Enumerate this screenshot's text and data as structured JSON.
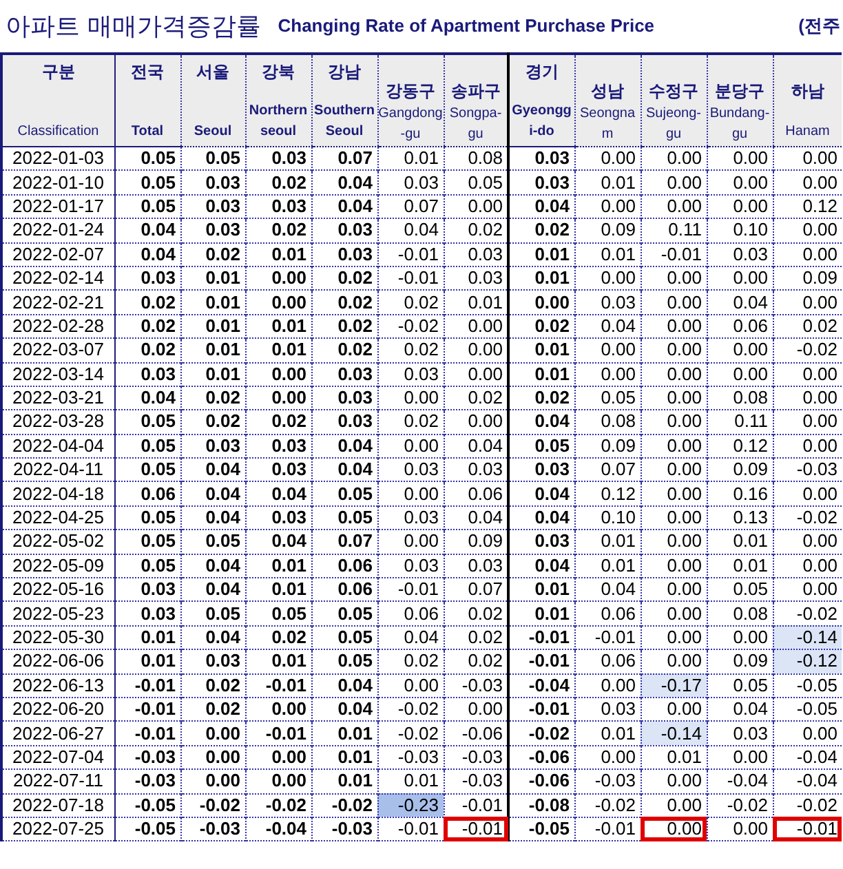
{
  "title": {
    "korean": "아파트 매매가격증감률",
    "english": "Changing Rate of Apartment Purchase Price",
    "note": "(전주"
  },
  "columns": [
    {
      "ko": "구분",
      "en": "Classification",
      "bold": false
    },
    {
      "ko": "전국",
      "en": "Total",
      "bold": true
    },
    {
      "ko": "서울",
      "en": "Seoul",
      "bold": true
    },
    {
      "ko": "강북",
      "en": "Northern seoul",
      "bold": true
    },
    {
      "ko": "강남",
      "en": "Southern Seoul",
      "bold": true
    },
    {
      "ko": "강동구",
      "en": "Gangdong -gu",
      "bold": false
    },
    {
      "ko": "송파구",
      "en": "Songpa- gu",
      "bold": false
    },
    {
      "ko": "경기",
      "en": "Gyeongg i-do",
      "bold": true
    },
    {
      "ko": "성남",
      "en": "Seongna m",
      "bold": false
    },
    {
      "ko": "수정구",
      "en": "Sujeong- gu",
      "bold": false
    },
    {
      "ko": "분당구",
      "en": "Bundang- gu",
      "bold": false
    },
    {
      "ko": "하남",
      "en": "Hanam",
      "bold": false
    }
  ],
  "rows": [
    {
      "date": "2022-01-03",
      "cells": [
        "0.05",
        "0.05",
        "0.03",
        "0.07",
        "0.01",
        "0.08",
        "0.03",
        "0.00",
        "0.00",
        "0.00",
        "0.00"
      ]
    },
    {
      "date": "2022-01-10",
      "cells": [
        "0.05",
        "0.03",
        "0.02",
        "0.04",
        "0.03",
        "0.05",
        "0.03",
        "0.01",
        "0.00",
        "0.00",
        "0.00"
      ]
    },
    {
      "date": "2022-01-17",
      "cells": [
        "0.05",
        "0.03",
        "0.03",
        "0.04",
        "0.07",
        "0.00",
        "0.04",
        "0.00",
        "0.00",
        "0.00",
        "0.12"
      ]
    },
    {
      "date": "2022-01-24",
      "cells": [
        "0.04",
        "0.03",
        "0.02",
        "0.03",
        "0.04",
        "0.02",
        "0.02",
        "0.09",
        "0.11",
        "0.10",
        "0.00"
      ]
    },
    {
      "date": "2022-02-07",
      "cells": [
        "0.04",
        "0.02",
        "0.01",
        "0.03",
        "-0.01",
        "0.03",
        "0.01",
        "0.01",
        "-0.01",
        "0.03",
        "0.00"
      ]
    },
    {
      "date": "2022-02-14",
      "cells": [
        "0.03",
        "0.01",
        "0.00",
        "0.02",
        "-0.01",
        "0.03",
        "0.01",
        "0.00",
        "0.00",
        "0.00",
        "0.09"
      ]
    },
    {
      "date": "2022-02-21",
      "cells": [
        "0.02",
        "0.01",
        "0.00",
        "0.02",
        "0.02",
        "0.01",
        "0.00",
        "0.03",
        "0.00",
        "0.04",
        "0.00"
      ]
    },
    {
      "date": "2022-02-28",
      "cells": [
        "0.02",
        "0.01",
        "0.01",
        "0.02",
        "-0.02",
        "0.00",
        "0.02",
        "0.04",
        "0.00",
        "0.06",
        "0.02"
      ]
    },
    {
      "date": "2022-03-07",
      "cells": [
        "0.02",
        "0.01",
        "0.01",
        "0.02",
        "0.02",
        "0.00",
        "0.01",
        "0.00",
        "0.00",
        "0.00",
        "-0.02"
      ]
    },
    {
      "date": "2022-03-14",
      "cells": [
        "0.03",
        "0.01",
        "0.00",
        "0.03",
        "0.03",
        "0.00",
        "0.01",
        "0.00",
        "0.00",
        "0.00",
        "0.00"
      ]
    },
    {
      "date": "2022-03-21",
      "cells": [
        "0.04",
        "0.02",
        "0.00",
        "0.03",
        "0.00",
        "0.02",
        "0.02",
        "0.05",
        "0.00",
        "0.08",
        "0.00"
      ]
    },
    {
      "date": "2022-03-28",
      "cells": [
        "0.05",
        "0.02",
        "0.02",
        "0.03",
        "0.02",
        "0.00",
        "0.04",
        "0.08",
        "0.00",
        "0.11",
        "0.00"
      ]
    },
    {
      "date": "2022-04-04",
      "cells": [
        "0.05",
        "0.03",
        "0.03",
        "0.04",
        "0.00",
        "0.04",
        "0.05",
        "0.09",
        "0.00",
        "0.12",
        "0.00"
      ]
    },
    {
      "date": "2022-04-11",
      "cells": [
        "0.05",
        "0.04",
        "0.03",
        "0.04",
        "0.03",
        "0.03",
        "0.03",
        "0.07",
        "0.00",
        "0.09",
        "-0.03"
      ]
    },
    {
      "date": "2022-04-18",
      "cells": [
        "0.06",
        "0.04",
        "0.04",
        "0.05",
        "0.00",
        "0.06",
        "0.04",
        "0.12",
        "0.00",
        "0.16",
        "0.00"
      ]
    },
    {
      "date": "2022-04-25",
      "cells": [
        "0.05",
        "0.04",
        "0.03",
        "0.05",
        "0.03",
        "0.04",
        "0.04",
        "0.10",
        "0.00",
        "0.13",
        "-0.02"
      ]
    },
    {
      "date": "2022-05-02",
      "cells": [
        "0.05",
        "0.05",
        "0.04",
        "0.07",
        "0.00",
        "0.09",
        "0.03",
        "0.01",
        "0.00",
        "0.01",
        "0.00"
      ]
    },
    {
      "date": "2022-05-09",
      "cells": [
        "0.05",
        "0.04",
        "0.01",
        "0.06",
        "0.03",
        "0.03",
        "0.04",
        "0.01",
        "0.00",
        "0.01",
        "0.00"
      ]
    },
    {
      "date": "2022-05-16",
      "cells": [
        "0.03",
        "0.04",
        "0.01",
        "0.06",
        "-0.01",
        "0.07",
        "0.01",
        "0.04",
        "0.00",
        "0.05",
        "0.00"
      ]
    },
    {
      "date": "2022-05-23",
      "cells": [
        "0.03",
        "0.05",
        "0.05",
        "0.05",
        "0.06",
        "0.02",
        "0.01",
        "0.06",
        "0.00",
        "0.08",
        "-0.02"
      ]
    },
    {
      "date": "2022-05-30",
      "cells": [
        "0.01",
        "0.04",
        "0.02",
        "0.05",
        "0.04",
        "0.02",
        "-0.01",
        "-0.01",
        "0.00",
        "0.00",
        {
          "value": "-0.14",
          "color": "#dbe5f6"
        }
      ]
    },
    {
      "date": "2022-06-06",
      "cells": [
        "0.01",
        "0.03",
        "0.01",
        "0.05",
        "0.02",
        "0.02",
        "-0.01",
        "0.06",
        "0.00",
        "0.09",
        {
          "value": "-0.12",
          "color": "#dbe5f6"
        }
      ]
    },
    {
      "date": "2022-06-13",
      "cells": [
        "-0.01",
        "0.02",
        "-0.01",
        "0.04",
        "0.00",
        "-0.03",
        "-0.04",
        "0.00",
        {
          "value": "-0.17",
          "color": "#dbe5f6"
        },
        "0.05",
        "-0.05"
      ]
    },
    {
      "date": "2022-06-20",
      "cells": [
        "-0.01",
        "0.02",
        "0.00",
        "0.04",
        "-0.02",
        "0.00",
        "-0.01",
        "0.03",
        "0.00",
        "0.04",
        "-0.05"
      ]
    },
    {
      "date": "2022-06-27",
      "cells": [
        "-0.01",
        "0.00",
        "-0.01",
        "0.01",
        "-0.02",
        "-0.06",
        "-0.02",
        "0.01",
        {
          "value": "-0.14",
          "color": "#dbe5f6"
        },
        "0.03",
        "0.00"
      ]
    },
    {
      "date": "2022-07-04",
      "cells": [
        "-0.03",
        "0.00",
        "0.00",
        "0.01",
        "-0.03",
        "-0.03",
        "-0.06",
        "0.00",
        "0.01",
        "0.00",
        "-0.04"
      ]
    },
    {
      "date": "2022-07-11",
      "cells": [
        "-0.03",
        "0.00",
        "0.00",
        "0.01",
        "0.01",
        "-0.03",
        "-0.06",
        "-0.03",
        "0.00",
        "-0.04",
        "-0.04"
      ]
    },
    {
      "date": "2022-07-18",
      "cells": [
        "-0.05",
        "-0.02",
        "-0.02",
        "-0.02",
        {
          "value": "-0.23",
          "color": "#a8bfea"
        },
        "-0.01",
        "-0.08",
        "-0.02",
        "0.00",
        "-0.02",
        "-0.02"
      ]
    },
    {
      "date": "2022-07-25",
      "cells": [
        "-0.05",
        "-0.03",
        "-0.04",
        "-0.03",
        "-0.01",
        {
          "value": "-0.01",
          "boxed": true
        },
        "-0.05",
        "-0.01",
        {
          "value": "0.00",
          "boxed": true
        },
        "0.00",
        {
          "value": "-0.01",
          "boxed": true
        }
      ]
    }
  ]
}
